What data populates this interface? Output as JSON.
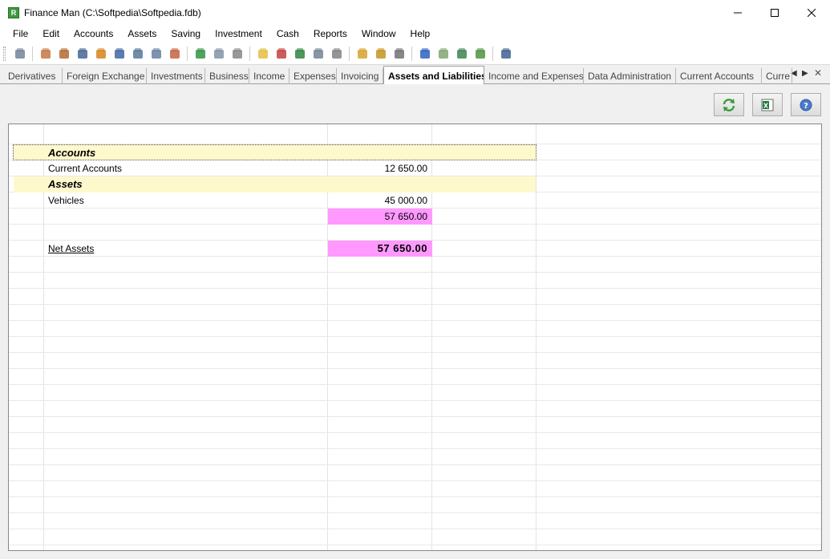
{
  "window": {
    "title": "Finance Man (C:\\Softpedia\\Softpedia.fdb)",
    "app_icon_letter": "R",
    "minimize_glyph": "—",
    "maximize_glyph": "☐",
    "close_glyph": "✕"
  },
  "menu": {
    "items": [
      "File",
      "Edit",
      "Accounts",
      "Assets",
      "Saving",
      "Investment",
      "Cash",
      "Reports",
      "Window",
      "Help"
    ]
  },
  "toolbar": {
    "icons": [
      {
        "name": "bank-icon",
        "color": "#7a8ca0"
      },
      {
        "name": "person-icon",
        "color": "#c8804a"
      },
      {
        "name": "house-people-icon",
        "color": "#b8733c"
      },
      {
        "name": "car-people-icon",
        "color": "#4f6f9a"
      },
      {
        "name": "house-icon",
        "color": "#d98b2b"
      },
      {
        "name": "car-icon",
        "color": "#4a6fa8"
      },
      {
        "name": "truck-icon",
        "color": "#5f7fa0"
      },
      {
        "name": "computer-icon",
        "color": "#6f87a7"
      },
      {
        "name": "person-card-icon",
        "color": "#c86b4a"
      },
      {
        "name": "money-plant-icon",
        "color": "#3d9a4d"
      },
      {
        "name": "cash-register-icon",
        "color": "#8a9aaa"
      },
      {
        "name": "printer-icon",
        "color": "#8d8d8d"
      },
      {
        "name": "new-document-icon",
        "color": "#e7c24a"
      },
      {
        "name": "pie-chart-icon",
        "color": "#c84a4a"
      },
      {
        "name": "globe-icon",
        "color": "#3c8c4c"
      },
      {
        "name": "scanner-icon",
        "color": "#7b8b9b"
      },
      {
        "name": "basket-icon",
        "color": "#8a8a8a"
      },
      {
        "name": "coins-icon",
        "color": "#d8a83a"
      },
      {
        "name": "coins-stack-icon",
        "color": "#c89a2a"
      },
      {
        "name": "calculator-icon",
        "color": "#7a7a7a"
      },
      {
        "name": "bar-chart-icon",
        "color": "#3a6ac0"
      },
      {
        "name": "document-add-icon",
        "color": "#8aaa7a"
      },
      {
        "name": "globe-search-icon",
        "color": "#4a8c5c"
      },
      {
        "name": "globe-refresh-icon",
        "color": "#5a9a4a"
      },
      {
        "name": "form-icon",
        "color": "#4a6a9a"
      }
    ]
  },
  "tabs": [
    {
      "label": "Derivatives",
      "active": false
    },
    {
      "label": "Foreign Exchange",
      "active": false
    },
    {
      "label": "Investments",
      "active": false
    },
    {
      "label": "Business",
      "active": false
    },
    {
      "label": "Income",
      "active": false
    },
    {
      "label": "Expenses",
      "active": false
    },
    {
      "label": "Invoicing",
      "active": false
    },
    {
      "label": "Assets and Liabilities",
      "active": true
    },
    {
      "label": "Income and Expenses",
      "active": false
    },
    {
      "label": "Data Administration",
      "active": false
    },
    {
      "label": "Current Accounts",
      "active": false
    },
    {
      "label": "Curre",
      "active": false
    }
  ],
  "tab_nav": {
    "prev": "◀",
    "next": "▶",
    "close": "✕"
  },
  "actions": {
    "refresh_icon": "refresh-icon",
    "excel_icon": "excel-icon",
    "help_icon": "help-icon"
  },
  "report": {
    "accounts_header": "Accounts",
    "current_accounts_label": "Current Accounts",
    "current_accounts_value": "12 650.00",
    "assets_header": "Assets",
    "vehicles_label": "Vehicles",
    "vehicles_value": "45 000.00",
    "subtotal_value": "57 650.00",
    "net_assets_label": "Net Assets",
    "net_assets_value": "57 650.00"
  },
  "colors": {
    "section_highlight": "#fef8cd",
    "total_highlight": "#ff99ff"
  }
}
